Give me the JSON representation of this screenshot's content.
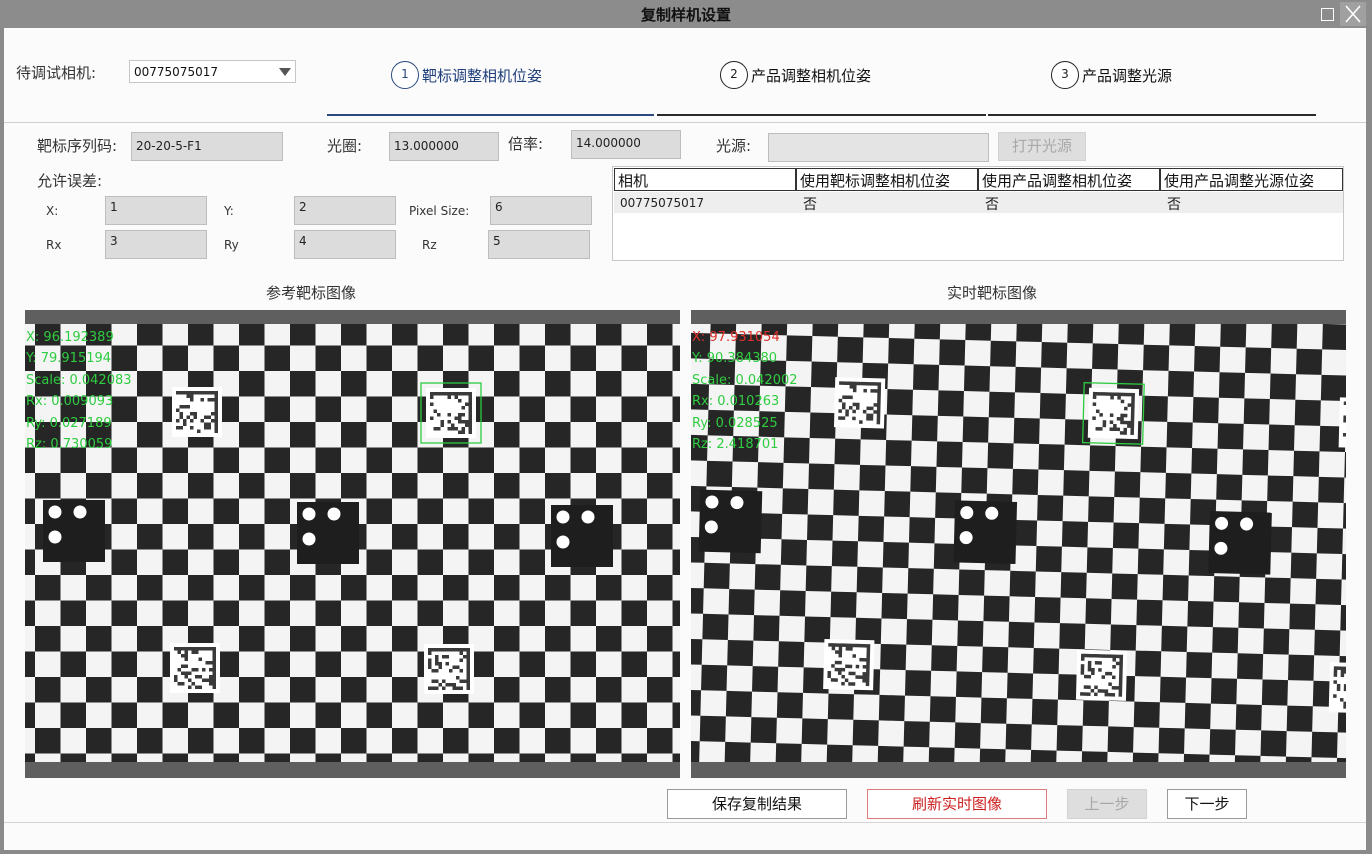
{
  "window": {
    "title": "复制样机设置"
  },
  "camera": {
    "label": "待调试相机:",
    "value": "00775075017"
  },
  "steps": [
    {
      "num": "1",
      "label": "靶标调整相机位姿"
    },
    {
      "num": "2",
      "label": "产品调整相机位姿"
    },
    {
      "num": "3",
      "label": "产品调整光源"
    }
  ],
  "params": {
    "serial_label": "靶标序列码:",
    "serial_value": "20-20-5-F1",
    "aperture_label": "光圈:",
    "aperture_value": "13.000000",
    "ratio_label": "倍率:",
    "ratio_value": "14.000000",
    "light_label": "光源:",
    "light_value": "",
    "open_light_label": "打开光源"
  },
  "tolerance": {
    "label": "允许误差:",
    "x_label": "X:",
    "x_value": "1",
    "y_label": "Y:",
    "y_value": "2",
    "pixel_label": "Pixel Size:",
    "pixel_value": "6",
    "rx_label": "Rx",
    "rx_value": "3",
    "ry_label": "Ry",
    "ry_value": "4",
    "rz_label": "Rz",
    "rz_value": "5"
  },
  "camera_table": {
    "headers": [
      "相机",
      "使用靶标调整相机位姿",
      "使用产品调整相机位姿",
      "使用产品调整光源位姿"
    ],
    "rows": [
      [
        "00775075017",
        "否",
        "否",
        "否"
      ]
    ]
  },
  "images": {
    "reference": {
      "title": "参考靶标图像",
      "overlay": [
        "X: 96.192389",
        "Y: 79.915194",
        "Scale: 0.042083",
        "Rx: 0.009093",
        "Ry: 0.027189",
        "Rz: 0.730059"
      ],
      "overlay_colors": [
        "#2ecc40",
        "#2ecc40",
        "#2ecc40",
        "#2ecc40",
        "#2ecc40",
        "#2ecc40"
      ]
    },
    "live": {
      "title": "实时靶标图像",
      "overlay": [
        "X: 97.931054",
        "Y: 90.384380",
        "Scale: 0.042002",
        "Rx: 0.010263",
        "Ry: 0.028525",
        "Rz: 2.418701"
      ],
      "overlay_colors": [
        "#e0302a",
        "#2ecc40",
        "#2ecc40",
        "#2ecc40",
        "#2ecc40",
        "#2ecc40"
      ]
    }
  },
  "buttons": {
    "save": "保存复制结果",
    "refresh": "刷新实时图像",
    "prev": "上一步",
    "next": "下一步"
  },
  "colors": {
    "accent": "#2b4a7e",
    "overlay_green": "#2ecc40",
    "overlay_red": "#e0302a",
    "refresh_red": "#cc2020"
  }
}
